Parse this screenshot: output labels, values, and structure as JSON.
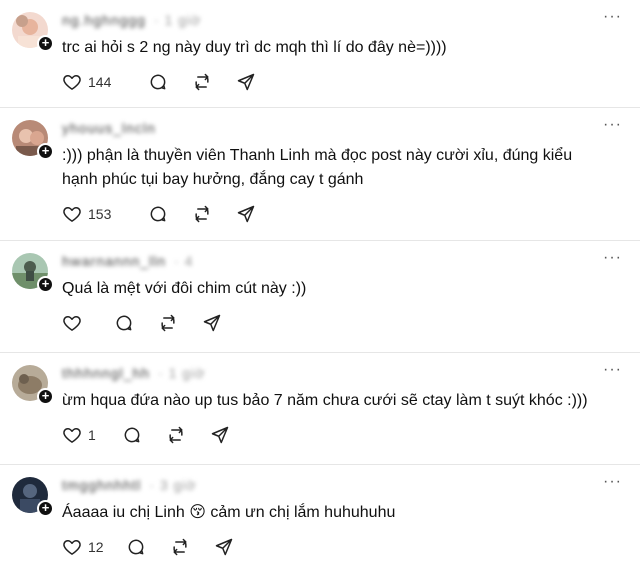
{
  "posts": [
    {
      "username": "ng.hghnggg",
      "username_extra": "· 1 giờ",
      "text": "trc ai hỏi s 2 ng này duy trì dc mqh thì lí do đây nè=))))",
      "likes": "144",
      "avatar_color": "#f1c9b5"
    },
    {
      "username": "yhouus_lncln",
      "username_extra": "",
      "text": ":))) phận là thuyền viên Thanh Linh mà đọc post này cười xỉu, đúng kiểu hạnh phúc tụi bay hưởng, đắng cay t gánh",
      "likes": "153",
      "avatar_color": "#c99a86"
    },
    {
      "username": "hwarnannn_lln",
      "username_extra": "· 4",
      "text": "Quá là mệt với đôi chim cút này :))",
      "likes": "",
      "avatar_color": "#7fa38a"
    },
    {
      "username": "thhhnngl_hh",
      "username_extra": "· 1 giờ",
      "text": "ừm hqua đứa nào up tus bảo 7 năm chưa cưới sẽ ctay làm t suýt khóc :)))",
      "likes": "1",
      "avatar_color": "#9b8f7e"
    },
    {
      "username": "tmgghnhhtl",
      "username_extra": "· 3 giờ",
      "text": "Áaaaa iu chị Linh 😚 cảm ưn chị lắm huhuhuhu",
      "likes": "12",
      "avatar_color": "#2b3a55"
    }
  ],
  "icons": {
    "more": "more-icon",
    "follow": "plus-icon",
    "like": "heart-icon",
    "reply": "comment-icon",
    "repost": "repost-icon",
    "share": "send-icon"
  },
  "more_label": "···",
  "follow_label": "+"
}
